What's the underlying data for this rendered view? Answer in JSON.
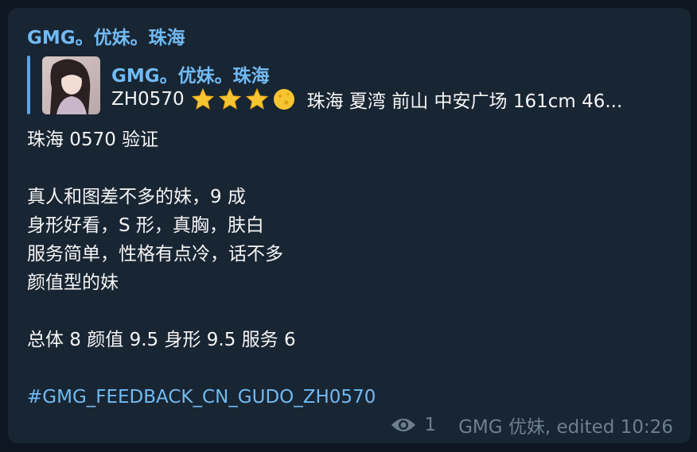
{
  "message": {
    "sender": "GMG。优妹。珠海",
    "reply": {
      "title": "GMG。优妹。珠海",
      "code": "ZH0570",
      "rating_icons": [
        "star-icon",
        "star-icon",
        "star-icon",
        "half-moon-icon"
      ],
      "rest": "珠海 夏湾 前山 中安广场 161cm  46..."
    },
    "lines": [
      "珠海 0570 验证",
      "",
      "真人和图差不多的妹，9 成",
      "身形好看，S 形，真胸，肤白",
      "服务简单，性格有点冷，话不多",
      "颜值型的妹",
      "",
      "总体 8   颜值 9.5   身形 9.5  服务 6",
      ""
    ],
    "hashtag": "#GMG_FEEDBACK_CN_GUDO_ZH0570",
    "views": "1",
    "footer": "GMG 优妹, edited 10:26"
  },
  "colors": {
    "background": "#0e1621",
    "bubble": "#182533",
    "accent": "#71baf2",
    "text": "#f5f5f5",
    "meta": "#6d7f8f",
    "star": "#f7c531"
  }
}
